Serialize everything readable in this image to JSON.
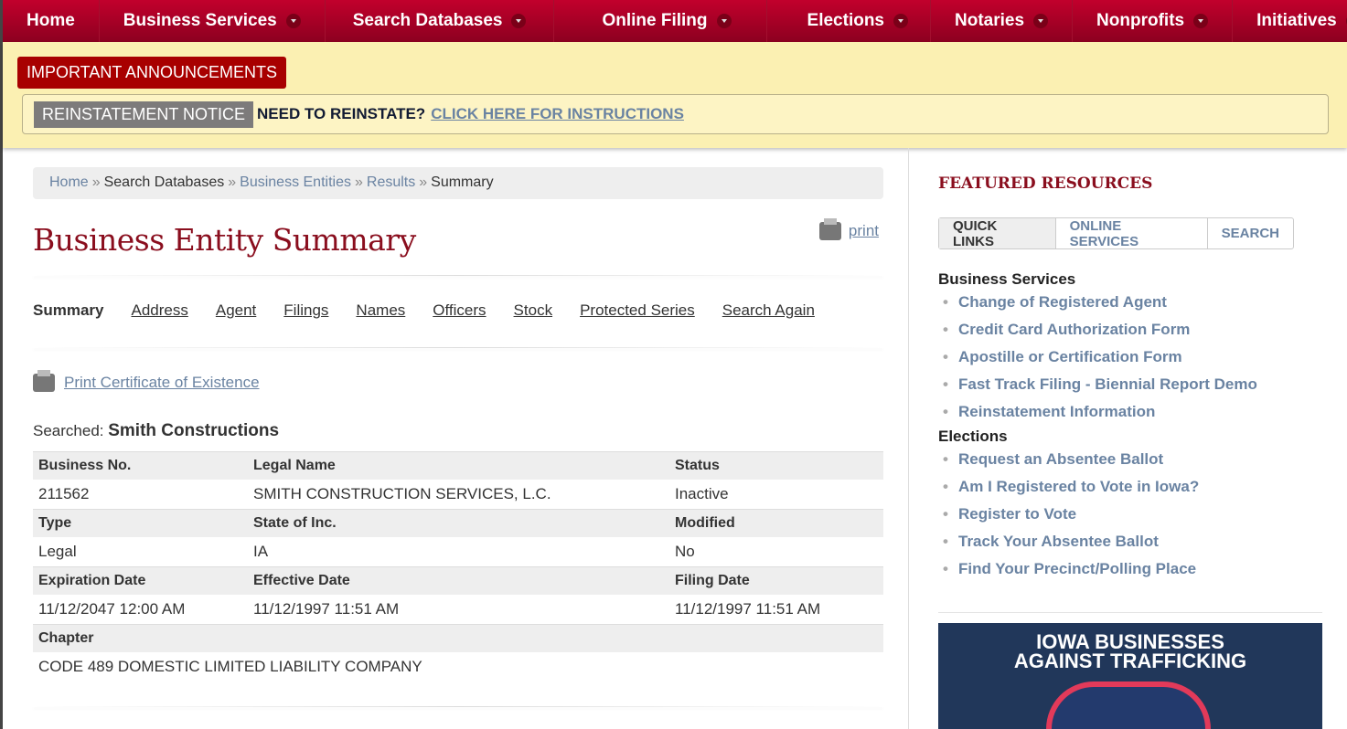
{
  "nav": [
    "Home",
    "Business Services",
    "Search Databases",
    "Online Filing",
    "Elections",
    "Notaries",
    "Nonprofits",
    "Initiatives"
  ],
  "announce": {
    "button": "IMPORTANT ANNOUNCEMENTS",
    "notice": "REINSTATEMENT NOTICE",
    "text": "NEED TO REINSTATE?",
    "link": "CLICK HERE FOR INSTRUCTIONS"
  },
  "breadcrumb": [
    "Home",
    "Search Databases",
    "Business Entities",
    "Results",
    "Summary"
  ],
  "title": "Business Entity Summary",
  "print": "print",
  "tabs": [
    "Summary",
    "Address",
    "Agent",
    "Filings",
    "Names",
    "Officers",
    "Stock",
    "Protected Series",
    "Search Again"
  ],
  "cert": "Print Certificate of Existence",
  "searched": {
    "label": "Searched:",
    "value": "Smith Constructions"
  },
  "table": {
    "h1": [
      "Business No.",
      "Legal Name",
      "Status"
    ],
    "r1": [
      "211562",
      "SMITH CONSTRUCTION SERVICES, L.C.",
      "Inactive"
    ],
    "h2": [
      "Type",
      "State of Inc.",
      "Modified"
    ],
    "r2": [
      "Legal",
      "IA",
      "No"
    ],
    "h3": [
      "Expiration Date",
      "Effective Date",
      "Filing Date"
    ],
    "r3": [
      "11/12/2047 12:00 AM",
      "11/12/1997 11:51 AM",
      "11/12/1997 11:51 AM"
    ],
    "h4": "Chapter",
    "r4": "CODE 489 DOMESTIC LIMITED LIABILITY COMPANY"
  },
  "sidebar": {
    "title": "FEATURED RESOURCES",
    "tabs": [
      "QUICK LINKS",
      "ONLINE SERVICES",
      "SEARCH"
    ],
    "business_heading": "Business Services",
    "business": [
      "Change of Registered Agent",
      "Credit Card Authorization Form",
      "Apostille or Certification Form",
      "Fast Track Filing - Biennial Report Demo",
      "Reinstatement Information"
    ],
    "elections_heading": "Elections",
    "elections": [
      "Request an Absentee Ballot",
      "Am I Registered to Vote in Iowa?",
      "Register to Vote",
      "Track Your Absentee Ballot",
      "Find Your Precinct/Polling Place"
    ],
    "banner": [
      "IOWA BUSINESSES",
      "AGAINST TRAFFICKING"
    ]
  }
}
